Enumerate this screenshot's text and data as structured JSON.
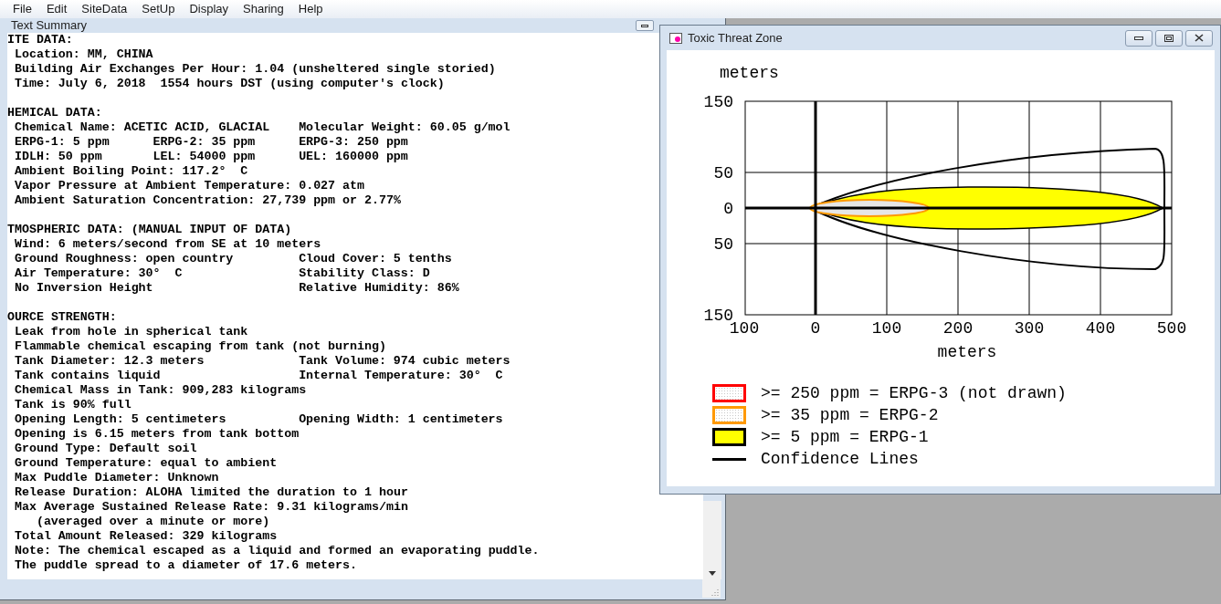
{
  "menu": [
    "File",
    "Edit",
    "SiteData",
    "SetUp",
    "Display",
    "Sharing",
    "Help"
  ],
  "text_window": {
    "title": "Text Summary",
    "sections": [
      {
        "heading": "ITE DATA:",
        "rows": [
          {
            "kind": "line",
            "cells": [
              "Location: MM, CHINA"
            ]
          },
          {
            "kind": "line",
            "cells": [
              "Building Air Exchanges Per Hour: 1.04 (unsheltered single storied)"
            ]
          },
          {
            "kind": "line",
            "cells": [
              "Time: July 6, 2018  1554 hours DST (using computer's clock)"
            ]
          }
        ]
      },
      {
        "heading": "HEMICAL DATA:",
        "rows": [
          {
            "kind": "line",
            "cells": [
              "Chemical Name: ACETIC ACID, GLACIAL",
              "",
              "Molecular Weight: 60.05 g/mol"
            ]
          },
          {
            "kind": "line",
            "cells": [
              "ERPG-1: 5 ppm",
              "ERPG-2: 35 ppm",
              "ERPG-3: 250 ppm"
            ]
          },
          {
            "kind": "line",
            "cells": [
              "IDLH: 50 ppm",
              "LEL: 54000 ppm",
              "UEL: 160000 ppm"
            ]
          },
          {
            "kind": "line",
            "cells": [
              "Ambient Boiling Point: 117.2°  C"
            ]
          },
          {
            "kind": "line",
            "cells": [
              "Vapor Pressure at Ambient Temperature: 0.027 atm"
            ]
          },
          {
            "kind": "line",
            "cells": [
              "Ambient Saturation Concentration: 27,739 ppm or 2.77%"
            ]
          }
        ]
      },
      {
        "heading": "TMOSPHERIC DATA: (MANUAL INPUT OF DATA)",
        "rows": [
          {
            "kind": "line",
            "cells": [
              "Wind: 6 meters/second from SE at 10 meters"
            ]
          },
          {
            "kind": "line",
            "cells": [
              "Ground Roughness: open country",
              "",
              "Cloud Cover: 5 tenths"
            ]
          },
          {
            "kind": "line",
            "cells": [
              "Air Temperature: 30°  C",
              "",
              "Stability Class: D"
            ]
          },
          {
            "kind": "line",
            "cells": [
              "No Inversion Height",
              "",
              "Relative Humidity: 86%"
            ]
          }
        ]
      },
      {
        "heading": "OURCE STRENGTH:",
        "rows": [
          {
            "kind": "line",
            "cells": [
              "Leak from hole in spherical tank"
            ]
          },
          {
            "kind": "line",
            "cells": [
              "Flammable chemical escaping from tank (not burning)"
            ]
          },
          {
            "kind": "line",
            "cells": [
              "Tank Diameter: 12.3 meters",
              "",
              "Tank Volume: 974 cubic meters"
            ]
          },
          {
            "kind": "line",
            "cells": [
              "Tank contains liquid",
              "",
              "Internal Temperature: 30°  C"
            ]
          },
          {
            "kind": "line",
            "cells": [
              "Chemical Mass in Tank: 909,283 kilograms"
            ]
          },
          {
            "kind": "line",
            "cells": [
              "Tank is 90% full"
            ]
          },
          {
            "kind": "line",
            "cells": [
              "Opening Length: 5 centimeters",
              "",
              "Opening Width: 1 centimeters"
            ]
          },
          {
            "kind": "line",
            "cells": [
              "Opening is 6.15 meters from tank bottom"
            ]
          },
          {
            "kind": "line",
            "cells": [
              "Ground Type: Default soil"
            ]
          },
          {
            "kind": "line",
            "cells": [
              "Ground Temperature: equal to ambient"
            ]
          },
          {
            "kind": "line",
            "cells": [
              "Max Puddle Diameter: Unknown"
            ]
          },
          {
            "kind": "line",
            "cells": [
              "Release Duration: ALOHA limited the duration to 1 hour"
            ]
          },
          {
            "kind": "line",
            "cells": [
              "Max Average Sustained Release Rate: 9.31 kilograms/min"
            ]
          },
          {
            "kind": "continued",
            "cells": [
              "(averaged over a minute or more)"
            ]
          },
          {
            "kind": "line",
            "cells": [
              "Total Amount Released: 329 kilograms"
            ]
          },
          {
            "kind": "line",
            "cells": [
              "Note: The chemical escaped as a liquid and formed an evaporating puddle."
            ]
          },
          {
            "kind": "line",
            "cells": [
              "The puddle spread to a diameter of 17.6 meters."
            ]
          }
        ]
      }
    ]
  },
  "plot_window": {
    "title": "Toxic Threat Zone",
    "y_label": "meters",
    "y_ticks": [
      "150",
      "50",
      "0",
      "50",
      "150"
    ],
    "x_ticks": [
      "100",
      "0",
      "100",
      "200",
      "300",
      "400",
      "500"
    ],
    "x_label": "meters",
    "legend": [
      {
        "kind": "dotted",
        "color": "#ff0000",
        "label": ">= 250 ppm = ERPG-3 (not drawn)"
      },
      {
        "kind": "dotted",
        "color": "#ff9900",
        "label": ">= 35 ppm = ERPG-2"
      },
      {
        "kind": "solid",
        "color": "#ffff00",
        "label": ">= 5 ppm = ERPG-1"
      },
      {
        "kind": "line",
        "color": "#000000",
        "label": "Confidence Lines"
      }
    ]
  }
}
